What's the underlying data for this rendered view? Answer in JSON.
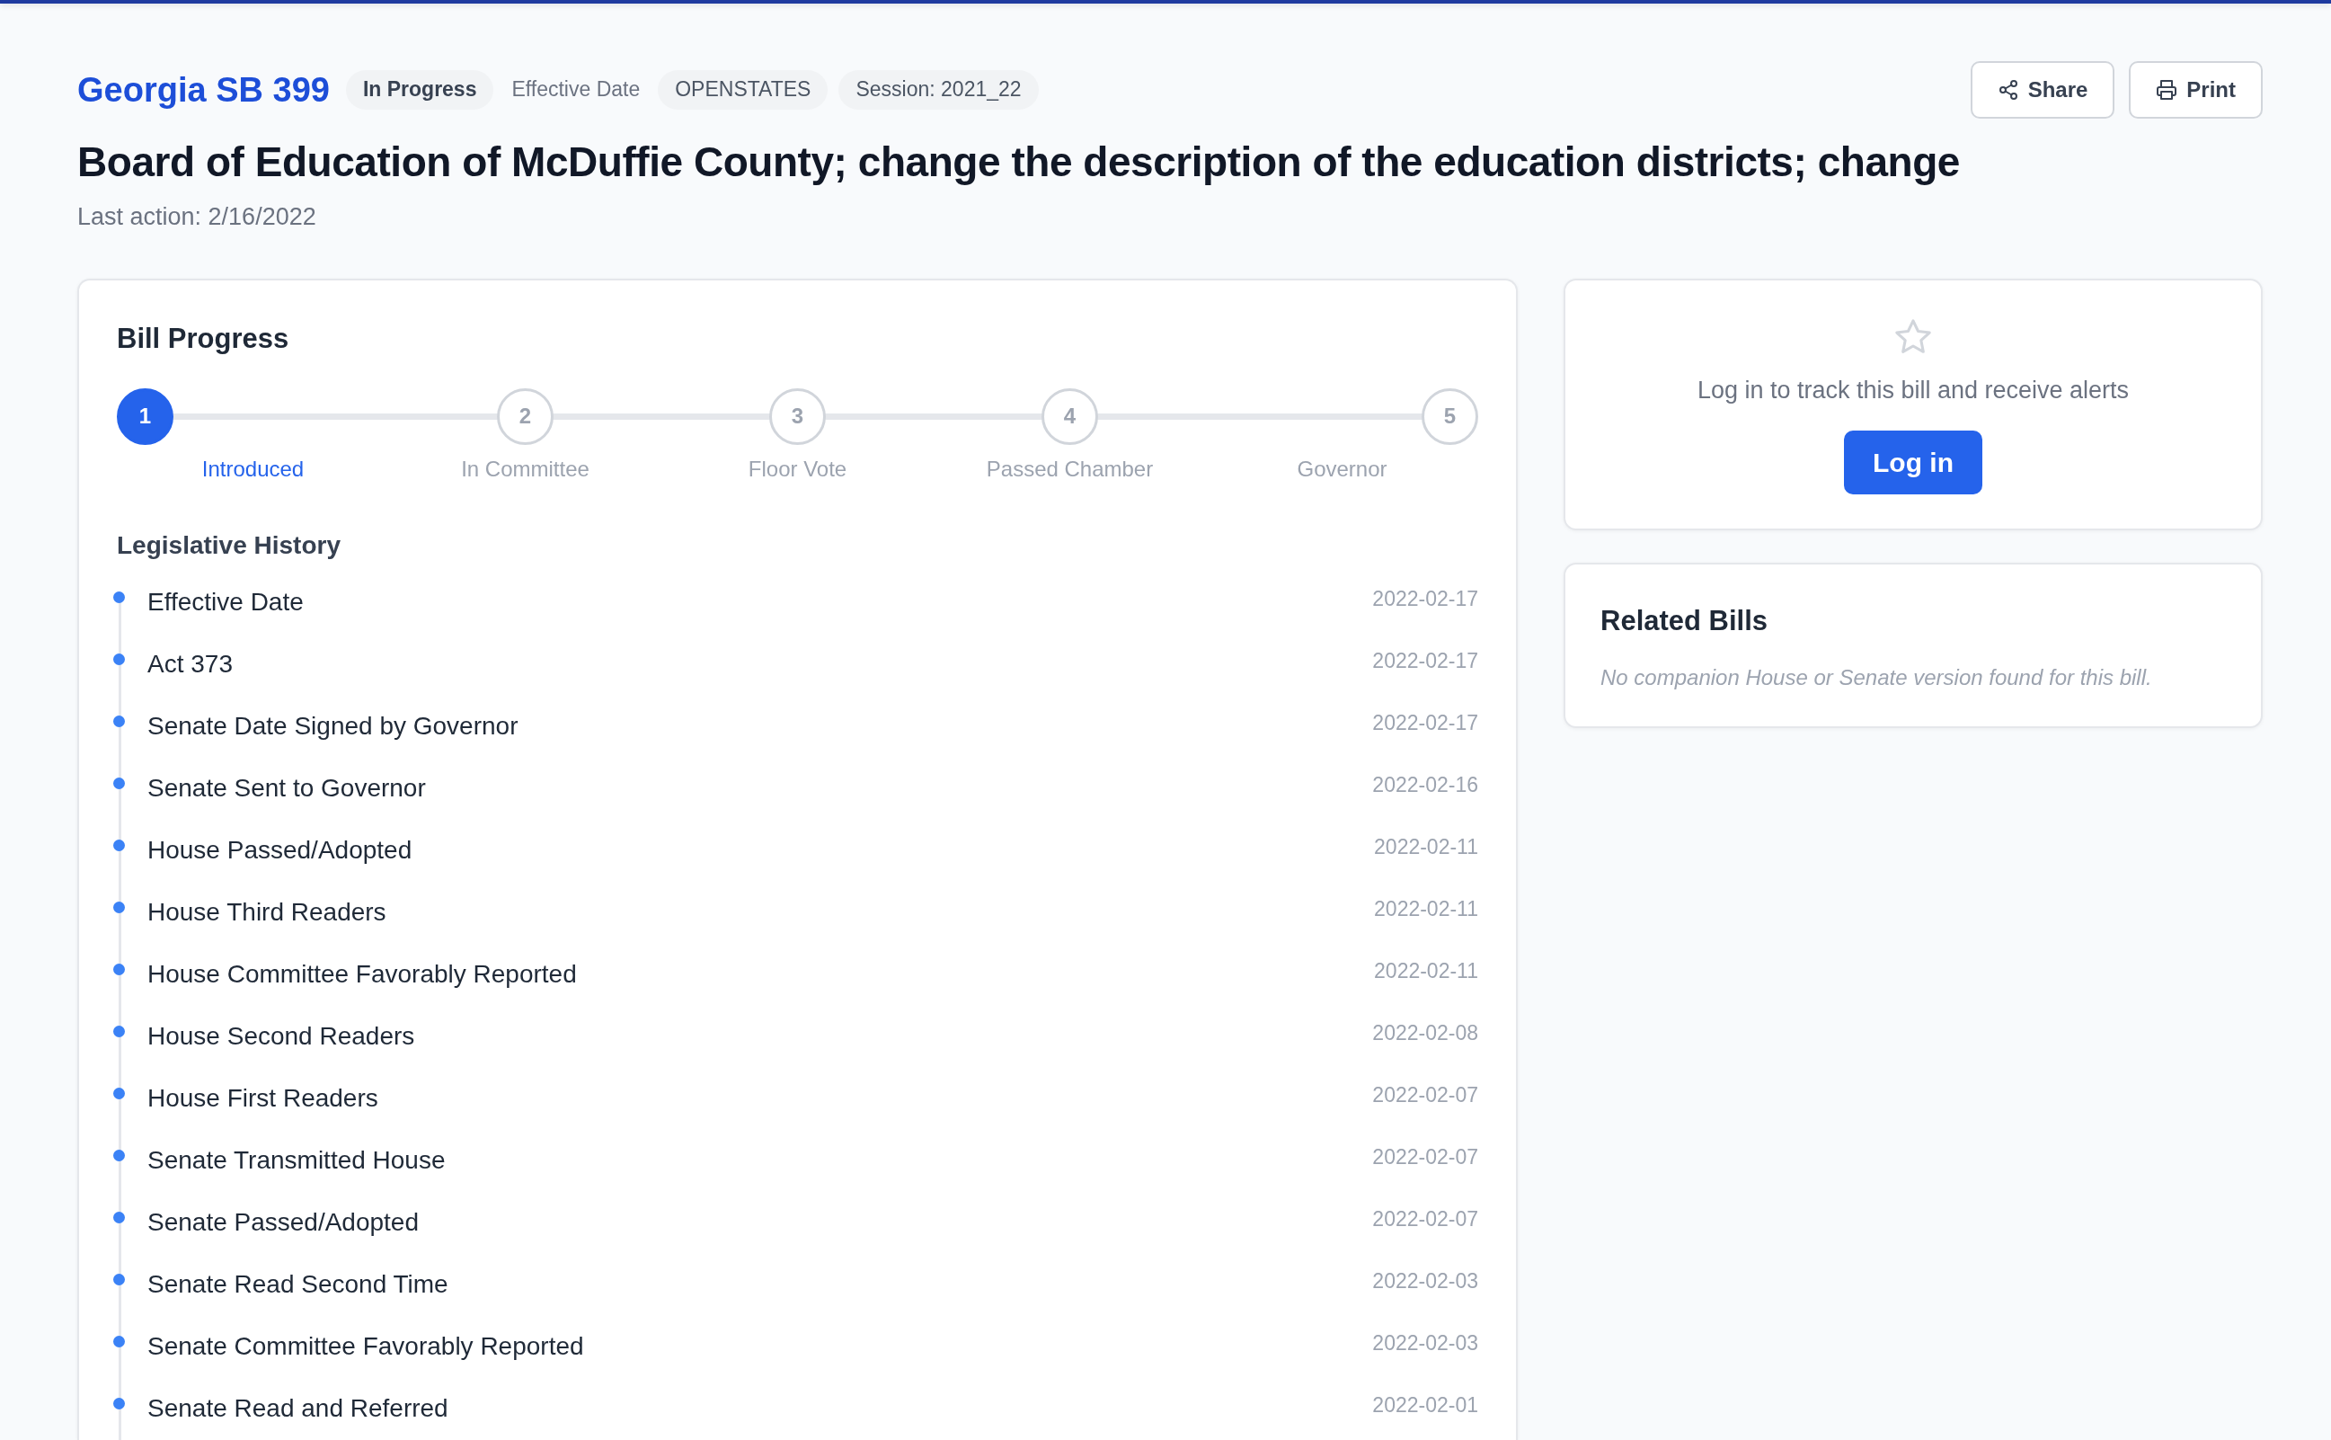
{
  "header": {
    "bill_id": "Georgia SB 399",
    "badges": [
      {
        "kind": "status",
        "text": "In Progress"
      },
      {
        "kind": "plain",
        "text": "Effective Date"
      },
      {
        "kind": "pill",
        "text": "OPENSTATES"
      },
      {
        "kind": "pill",
        "text": "Session: 2021_22"
      }
    ],
    "actions": [
      {
        "kind": "share",
        "label": "Share"
      },
      {
        "kind": "print",
        "label": "Print"
      }
    ],
    "title": "Board of Education of McDuffie County; change the description of the education districts; change",
    "last_action": "Last action: 2/16/2022"
  },
  "bill_progress": {
    "title": "Bill Progress",
    "steps": [
      {
        "number": "1",
        "label": "Introduced",
        "active": true
      },
      {
        "number": "2",
        "label": "In Committee",
        "active": false
      },
      {
        "number": "3",
        "label": "Floor Vote",
        "active": false
      },
      {
        "number": "4",
        "label": "Passed Chamber",
        "active": false
      },
      {
        "number": "5",
        "label": "Governor",
        "active": false
      }
    ]
  },
  "legislative_history": {
    "title": "Legislative History",
    "events": [
      {
        "action": "Effective Date",
        "date": "2022-02-17"
      },
      {
        "action": "Act 373",
        "date": "2022-02-17"
      },
      {
        "action": "Senate Date Signed by Governor",
        "date": "2022-02-17"
      },
      {
        "action": "Senate Sent to Governor",
        "date": "2022-02-16"
      },
      {
        "action": "House Passed/Adopted",
        "date": "2022-02-11"
      },
      {
        "action": "House Third Readers",
        "date": "2022-02-11"
      },
      {
        "action": "House Committee Favorably Reported",
        "date": "2022-02-11"
      },
      {
        "action": "House Second Readers",
        "date": "2022-02-08"
      },
      {
        "action": "House First Readers",
        "date": "2022-02-07"
      },
      {
        "action": "Senate Transmitted House",
        "date": "2022-02-07"
      },
      {
        "action": "Senate Passed/Adopted",
        "date": "2022-02-07"
      },
      {
        "action": "Senate Read Second Time",
        "date": "2022-02-03"
      },
      {
        "action": "Senate Committee Favorably Reported",
        "date": "2022-02-03"
      },
      {
        "action": "Senate Read and Referred",
        "date": "2022-02-01"
      }
    ]
  },
  "tracking": {
    "message": "Log in to track this bill and receive alerts",
    "button": "Log in"
  },
  "related_bills": {
    "title": "Related Bills",
    "empty_message": "No companion House or Senate version found for this bill."
  }
}
